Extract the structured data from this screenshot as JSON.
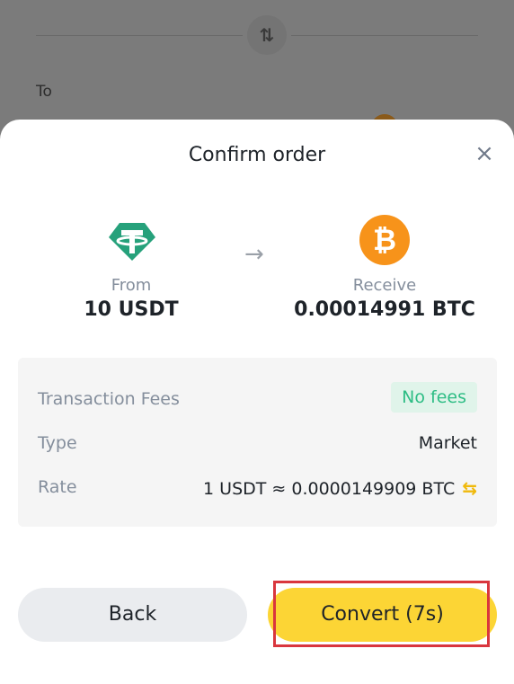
{
  "background": {
    "to_label": "To"
  },
  "dialog": {
    "title": "Confirm order",
    "close_icon": "close-icon"
  },
  "conversion": {
    "from_label": "From",
    "from_value": "10 USDT",
    "from_icon": "usdt-icon",
    "arrow_icon": "arrow-right-icon",
    "receive_label": "Receive",
    "receive_value": "0.00014991 BTC",
    "receive_icon": "btc-icon"
  },
  "details": {
    "fees_label": "Transaction Fees",
    "fees_value": "No fees",
    "type_label": "Type",
    "type_value": "Market",
    "rate_label": "Rate",
    "rate_value": "1 USDT ≈ 0.0000149909 BTC",
    "rate_swap_icon": "swap-icon"
  },
  "buttons": {
    "back_label": "Back",
    "convert_label": "Convert (7s)"
  },
  "colors": {
    "accent": "#fcd535",
    "usdt": "#26a17b",
    "btc": "#f7931a",
    "fee_green": "#2ebd85",
    "highlight": "#d9363e"
  }
}
